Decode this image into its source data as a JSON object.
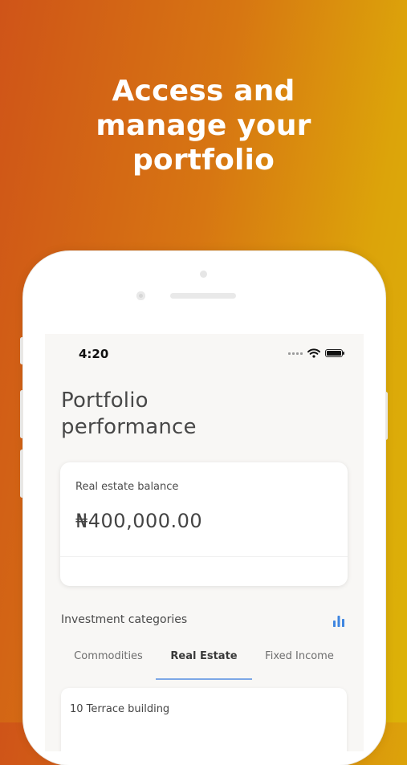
{
  "headline": {
    "line1": "Access and",
    "line2": "manage your",
    "line3": "portfolio"
  },
  "status_bar": {
    "time": "4:20"
  },
  "page": {
    "title_line1": "Portfolio",
    "title_line2": "performance"
  },
  "balance_card": {
    "label": "Real estate balance",
    "amount": "₦400,000.00"
  },
  "categories": {
    "title": "Investment categories",
    "tabs": [
      {
        "label": "Commodities",
        "active": false
      },
      {
        "label": "Real Estate",
        "active": true
      },
      {
        "label": "Fixed Income",
        "active": false
      }
    ]
  },
  "investments": [
    {
      "name": "10 Terrace building"
    }
  ],
  "colors": {
    "gradient_start": "#cf5418",
    "gradient_end": "#dcb308",
    "accent_blue": "#3f86e0",
    "tab_underline": "#7da7e6"
  },
  "icons": [
    "wifi-icon",
    "battery-icon",
    "signal-icon",
    "bar-chart-icon"
  ]
}
